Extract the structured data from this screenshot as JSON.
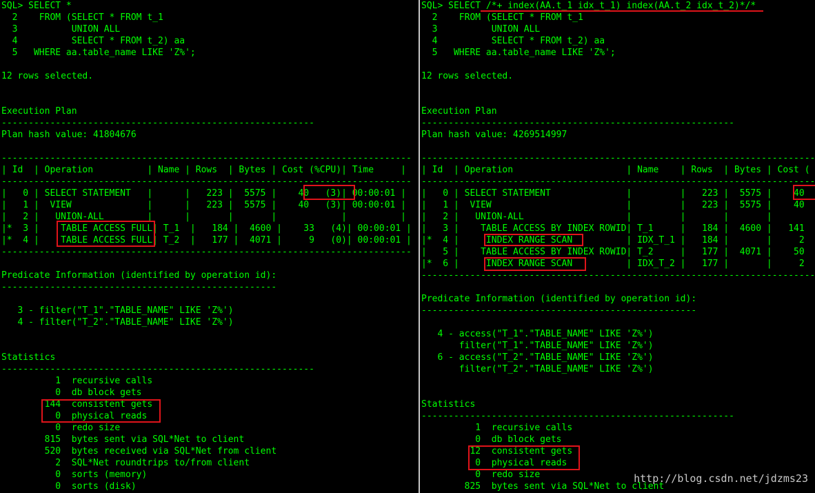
{
  "left": {
    "lines": [
      "SQL> SELECT *",
      "  2    FROM (SELECT * FROM t_1",
      "  3          UNION ALL",
      "  4          SELECT * FROM t_2) aa",
      "  5   WHERE aa.table_name LIKE 'Z%';",
      "",
      "12 rows selected.",
      "",
      "",
      "Execution Plan",
      "----------------------------------------------------------",
      "Plan hash value: 41804676",
      "",
      "----------------------------------------------------------------------------",
      "| Id  | Operation          | Name | Rows  | Bytes | Cost (%CPU)| Time     |",
      "----------------------------------------------------------------------------",
      "|   0 | SELECT STATEMENT   |      |   223 |  5575 |    40   (3)| 00:00:01 |",
      "|   1 |  VIEW              |      |   223 |  5575 |    40   (3)| 00:00:01 |",
      "|   2 |   UNION-ALL        |      |       |       |            |          |",
      "|*  3 |    TABLE ACCESS FULL| T_1  |   184 |  4600 |    33   (4)| 00:00:01 |",
      "|*  4 |    TABLE ACCESS FULL| T_2  |   177 |  4071 |     9   (0)| 00:00:01 |",
      "----------------------------------------------------------------------------",
      "",
      "Predicate Information (identified by operation id):",
      "---------------------------------------------------",
      "",
      "   3 - filter(\"T_1\".\"TABLE_NAME\" LIKE 'Z%')",
      "   4 - filter(\"T_2\".\"TABLE_NAME\" LIKE 'Z%')",
      "",
      "",
      "Statistics",
      "----------------------------------------------------------",
      "          1  recursive calls",
      "          0  db block gets",
      "        144  consistent gets",
      "          0  physical reads",
      "          0  redo size",
      "        815  bytes sent via SQL*Net to client",
      "        520  bytes received via SQL*Net from client",
      "          2  SQL*Net roundtrips to/from client",
      "          0  sorts (memory)",
      "          0  sorts (disk)"
    ]
  },
  "right": {
    "lines": [
      "SQL> SELECT /*+ index(AA.t_1 idx_t_1) index(AA.t_2 idx_t_2)*/*",
      "  2    FROM (SELECT * FROM t_1",
      "  3          UNION ALL",
      "  4          SELECT * FROM t_2) aa",
      "  5   WHERE aa.table_name LIKE 'Z%';",
      "",
      "12 rows selected.",
      "",
      "",
      "Execution Plan",
      "----------------------------------------------------------",
      "Plan hash value: 4269514997",
      "",
      "-----------------------------------------------------------------------------",
      "| Id  | Operation                     | Name    | Rows  | Bytes | Cost (",
      "-----------------------------------------------------------------------------",
      "|   0 | SELECT STATEMENT              |         |   223 |  5575 |    40",
      "|   1 |  VIEW                         |         |   223 |  5575 |    40",
      "|   2 |   UNION-ALL                   |         |       |       |",
      "|   3 |    TABLE ACCESS BY INDEX ROWID| T_1     |   184 |  4600 |   141",
      "|*  4 |     INDEX RANGE SCAN          | IDX_T_1 |   184 |       |     2",
      "|   5 |    TABLE ACCESS BY INDEX ROWID| T_2     |   177 |  4071 |    50",
      "|*  6 |     INDEX RANGE SCAN          | IDX_T_2 |   177 |       |     2",
      "-----------------------------------------------------------------------------",
      "",
      "Predicate Information (identified by operation id):",
      "---------------------------------------------------",
      "",
      "   4 - access(\"T_1\".\"TABLE_NAME\" LIKE 'Z%')",
      "       filter(\"T_1\".\"TABLE_NAME\" LIKE 'Z%')",
      "   6 - access(\"T_2\".\"TABLE_NAME\" LIKE 'Z%')",
      "       filter(\"T_2\".\"TABLE_NAME\" LIKE 'Z%')",
      "",
      "",
      "Statistics",
      "----------------------------------------------------------",
      "          1  recursive calls",
      "          0  db block gets",
      "         12  consistent gets",
      "          0  physical reads",
      "          0  redo size",
      "        825  bytes sent via SQL*Net to client"
    ]
  },
  "watermark": "http://blog.csdn.net/jdzms23",
  "colors": {
    "background": "#000000",
    "text": "#00ff00",
    "highlight": "#e0141a"
  }
}
